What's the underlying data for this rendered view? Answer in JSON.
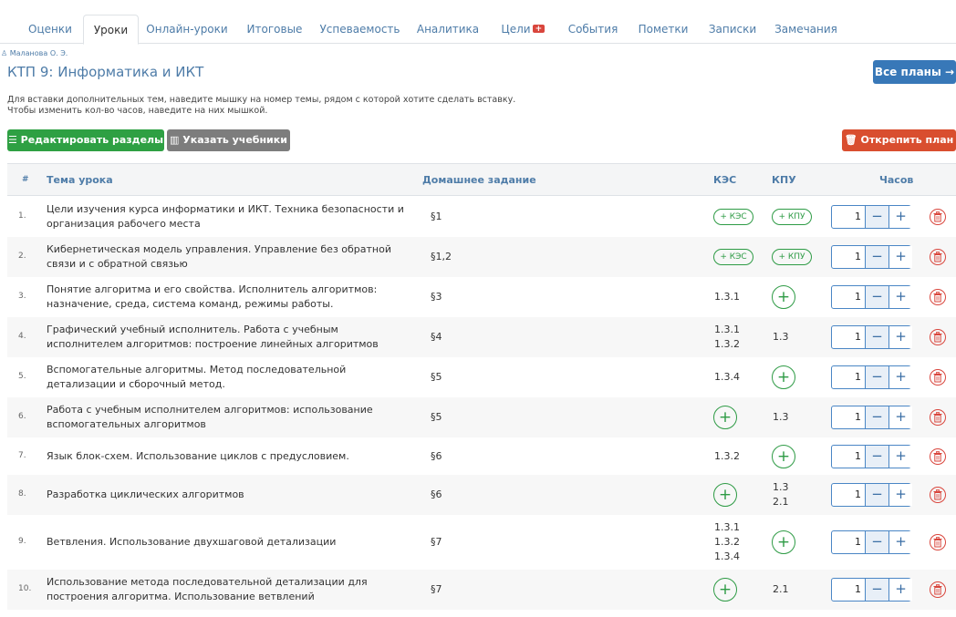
{
  "tabs": [
    "Оценки",
    "Уроки",
    "Онлайн-уроки",
    "Итоговые",
    "Успеваемость",
    "Аналитика",
    "Цели",
    "События",
    "Пометки",
    "Записки",
    "Замечания"
  ],
  "active_tab": "Уроки",
  "author": "Маланова О. Э.",
  "page_title": "КТП 9: Информатика и ИКТ",
  "all_plans_label": "Все планы →",
  "hint_line1": "Для вставки дополнительных тем, наведите мышку на номер темы, рядом с которой хотите сделать вставку.",
  "hint_line2": "Чтобы изменить кол-во часов, наведите на них мышкой.",
  "buttons": {
    "edit_sections": "☰ Редактировать разделы",
    "textbooks": "▥ Указать учебники",
    "unpin": "🗑 Открепить план"
  },
  "table_headers": {
    "num": "#",
    "topic": "Тема урока",
    "homework": "Домашнее задание",
    "kes": "КЭС",
    "kpu": "КПУ",
    "hours": "Часов"
  },
  "kes_pill_label": "+ КЭС",
  "kpu_pill_label": "+ КПУ",
  "lessons": [
    {
      "num": "1.",
      "topic": "Цели изучения курса информатики и ИКТ. Техника безопасности и организация рабочего места",
      "homework": "§1",
      "kes": "",
      "kpu": "",
      "hours": "1"
    },
    {
      "num": "2.",
      "topic": "Кибернетическая модель управления. Управление без обратной связи и с обратной связью",
      "homework": "§1,2",
      "kes": "",
      "kpu": "",
      "hours": "1"
    },
    {
      "num": "3.",
      "topic": "Понятие алгоритма и его свойства. Исполнитель алгоритмов: назначение, среда, система команд, режимы работы.",
      "homework": "§3",
      "kes": "1.3.1",
      "kpu": "",
      "hours": "1"
    },
    {
      "num": "4.",
      "topic": "Графический учебный исполнитель. Работа с учебным исполнителем алгоритмов: построение линейных алгоритмов",
      "homework": "§4",
      "kes": "1.3.1\n1.3.2",
      "kpu": "1.3",
      "hours": "1"
    },
    {
      "num": "5.",
      "topic": "Вспомогательные алгоритмы. Метод последовательной детализации и сборочный метод.",
      "homework": "§5",
      "kes": "1.3.4",
      "kpu": "",
      "hours": "1"
    },
    {
      "num": "6.",
      "topic": "Работа с учебным исполнителем алгоритмов: использование вспомогательных алгоритмов",
      "homework": "§5",
      "kes": "",
      "kpu": "1.3",
      "hours": "1"
    },
    {
      "num": "7.",
      "topic": "Язык блок-схем. Использование циклов с предусловием.",
      "homework": "§6",
      "kes": "1.3.2",
      "kpu": "",
      "hours": "1"
    },
    {
      "num": "8.",
      "topic": "Разработка циклических алгоритмов",
      "homework": "§6",
      "kes": "",
      "kpu": "1.3\n2.1",
      "hours": "1"
    },
    {
      "num": "9.",
      "topic": "Ветвления. Использование двухшаговой детализации",
      "homework": "§7",
      "kes": "1.3.1\n1.3.2\n1.3.4",
      "kpu": "",
      "hours": "1"
    },
    {
      "num": "10.",
      "topic": "Использование метода последовательной детализации для построения алгоритма. Использование ветвлений",
      "homework": "§7",
      "kes": "",
      "kpu": "2.1",
      "hours": "1"
    }
  ]
}
